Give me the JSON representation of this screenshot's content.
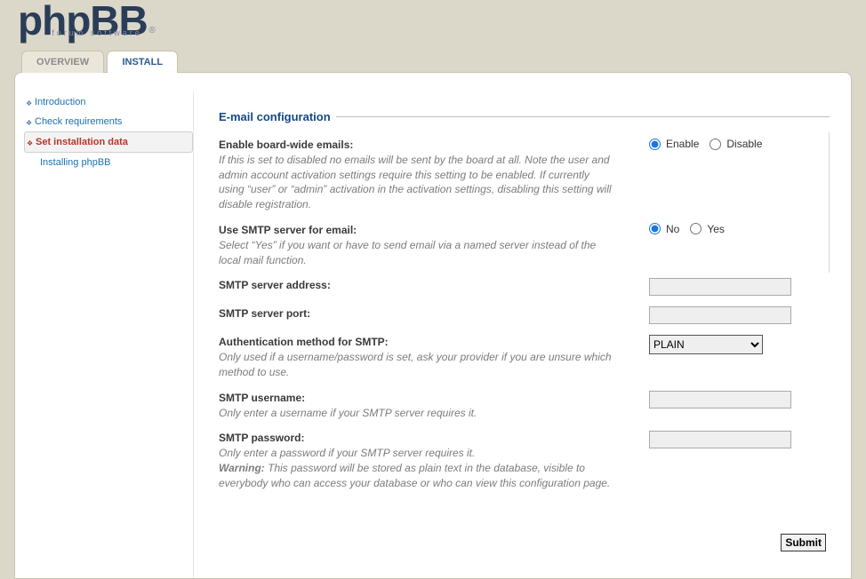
{
  "logo": {
    "tagline": "forum software"
  },
  "tabs": [
    {
      "label": "OVERVIEW",
      "active": false
    },
    {
      "label": "INSTALL",
      "active": true
    }
  ],
  "sidebar": {
    "items": [
      {
        "label": "Introduction",
        "current": false,
        "bullet": true
      },
      {
        "label": "Check requirements",
        "current": false,
        "bullet": true
      },
      {
        "label": "Set installation data",
        "current": true,
        "bullet": true
      },
      {
        "label": "Installing phpBB",
        "current": false,
        "bullet": false
      }
    ]
  },
  "section": {
    "title": "E-mail configuration"
  },
  "fields": {
    "enable_emails": {
      "title": "Enable board-wide emails:",
      "desc": "If this is set to disabled no emails will be sent by the board at all. Note the user and admin account activation settings require this setting to be enabled. If currently using “user” or “admin” activation in the activation settings, disabling this setting will disable registration.",
      "opt1": "Enable",
      "opt2": "Disable",
      "selected": "Enable"
    },
    "use_smtp": {
      "title": "Use SMTP server for email:",
      "desc": "Select “Yes” if you want or have to send email via a named server instead of the local mail function.",
      "opt1": "No",
      "opt2": "Yes",
      "selected": "No"
    },
    "smtp_address": {
      "title": "SMTP server address:",
      "value": ""
    },
    "smtp_port": {
      "title": "SMTP server port:",
      "value": ""
    },
    "auth_method": {
      "title": "Authentication method for SMTP:",
      "desc": "Only used if a username/password is set, ask your provider if you are unsure which method to use.",
      "value": "PLAIN"
    },
    "smtp_user": {
      "title": "SMTP username:",
      "desc": "Only enter a username if your SMTP server requires it.",
      "value": ""
    },
    "smtp_pass": {
      "title": "SMTP password:",
      "desc": "Only enter a password if your SMTP server requires it.",
      "warn_label": "Warning:",
      "warn_text": " This password will be stored as plain text in the database, visible to everybody who can access your database or who can view this configuration page.",
      "value": ""
    }
  },
  "submit": {
    "label": "Submit"
  }
}
